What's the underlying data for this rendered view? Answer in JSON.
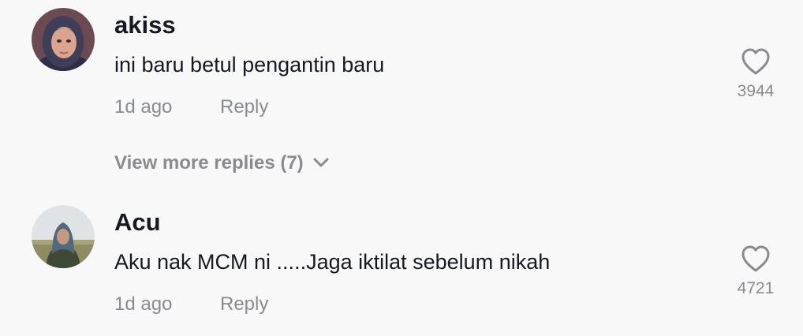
{
  "comments": [
    {
      "username": "akiss",
      "text": "ini baru betul pengantin baru",
      "time": "1d ago",
      "reply_label": "Reply",
      "likes": "3944",
      "avatar_icon": "user-avatar"
    },
    {
      "username": "Acu",
      "text": "Aku nak MCM ni .....Jaga iktilat sebelum nikah",
      "time": "1d ago",
      "reply_label": "Reply",
      "likes": "4721",
      "avatar_icon": "user-avatar"
    }
  ],
  "view_more": {
    "label": "View more replies (7)",
    "icon": "chevron-down-icon"
  },
  "colors": {
    "background": "#f8f8f8",
    "text_primary": "#161823",
    "text_secondary": "#8a8b91"
  }
}
